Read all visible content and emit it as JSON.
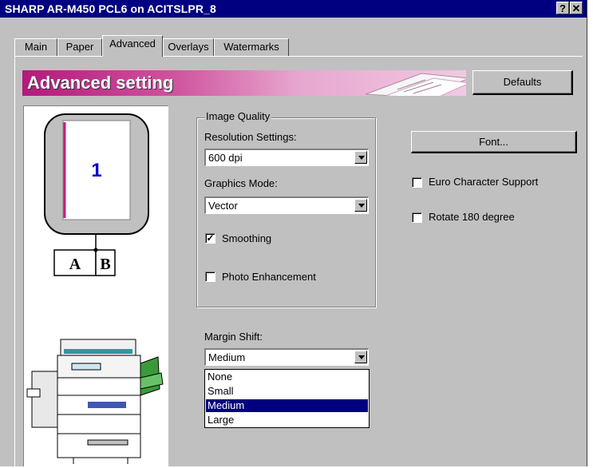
{
  "window": {
    "title": "SHARP AR-M450 PCL6 on ACITSLPR_8",
    "help_label": "?",
    "close_label": "✕"
  },
  "tabs": [
    {
      "label": "Main"
    },
    {
      "label": "Paper"
    },
    {
      "label": "Advanced"
    },
    {
      "label": "Overlays"
    },
    {
      "label": "Watermarks"
    }
  ],
  "active_tab": "Advanced",
  "banner": {
    "title": "Advanced setting"
  },
  "defaults_button": {
    "label": "Defaults"
  },
  "preview": {
    "page_number": "1",
    "binding_left": "A",
    "binding_right": "B"
  },
  "image_quality": {
    "group_label": "Image Quality",
    "resolution_label": "Resolution Settings:",
    "resolution_value": "600 dpi",
    "graphics_mode_label": "Graphics Mode:",
    "graphics_mode_value": "Vector",
    "smoothing": {
      "label": "Smoothing",
      "checked": true
    },
    "photo_enhancement": {
      "label": "Photo Enhancement",
      "checked": false
    }
  },
  "margin_shift": {
    "label": "Margin Shift:",
    "value": "Medium",
    "options": [
      "None",
      "Small",
      "Medium",
      "Large"
    ],
    "selected_index": 2
  },
  "font_button": {
    "label": "Font..."
  },
  "euro_support": {
    "label": "Euro Character Support",
    "checked": false
  },
  "rotate_180": {
    "label": "Rotate 180 degree",
    "checked": false
  },
  "colors": {
    "title_bar": "#000080",
    "banner_start": "#b3197c",
    "banner_end": "#f2c9e2",
    "selection": "#000080",
    "page_number": "#0000cc",
    "face": "#c0c0c0"
  }
}
